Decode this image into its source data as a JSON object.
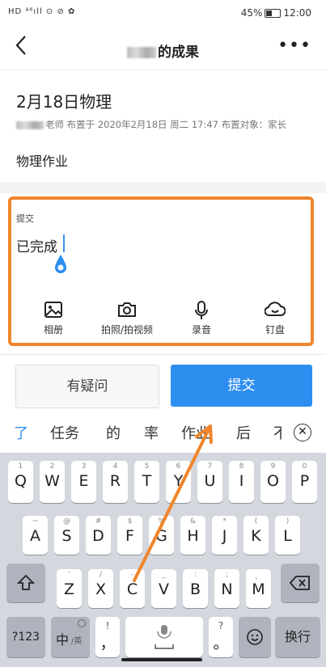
{
  "status": {
    "left": "HD ⁴⁶ıll ⊙ ⊘ ✿",
    "battery": "45%",
    "time": "12:00"
  },
  "nav": {
    "back": "‹",
    "title_suffix": "的成果",
    "more": "•••"
  },
  "assignment": {
    "title": "2月18日物理",
    "meta": "老师 布置于 2020年2月18日 周二 17:47 布置对象：家长",
    "task": "物理作业"
  },
  "submission": {
    "label": "提交",
    "answer": "已完成",
    "tools": [
      {
        "label": "相册",
        "icon": "image-icon"
      },
      {
        "label": "拍照/拍视频",
        "icon": "camera-icon"
      },
      {
        "label": "录音",
        "icon": "microphone-icon"
      },
      {
        "label": "钉盘",
        "icon": "cloud-icon"
      }
    ]
  },
  "buttons": {
    "question": "有疑问",
    "submit": "提交"
  },
  "candidates": [
    "了",
    "任务",
    "的",
    "率",
    "作业",
    "后",
    "不"
  ],
  "keyboard": {
    "row1": [
      {
        "k": "Q",
        "s": "1"
      },
      {
        "k": "W",
        "s": "2"
      },
      {
        "k": "E",
        "s": "3"
      },
      {
        "k": "R",
        "s": "4"
      },
      {
        "k": "T",
        "s": "5"
      },
      {
        "k": "Y",
        "s": "6"
      },
      {
        "k": "U",
        "s": "7"
      },
      {
        "k": "I",
        "s": "8"
      },
      {
        "k": "O",
        "s": "9"
      },
      {
        "k": "P",
        "s": "0"
      }
    ],
    "row2": [
      {
        "k": "A",
        "s": "~"
      },
      {
        "k": "S",
        "s": "@"
      },
      {
        "k": "D",
        "s": "#"
      },
      {
        "k": "F",
        "s": "$"
      },
      {
        "k": "G",
        "s": "%"
      },
      {
        "k": "H",
        "s": "&"
      },
      {
        "k": "J",
        "s": "*"
      },
      {
        "k": "K",
        "s": "("
      },
      {
        "k": "L",
        "s": ")"
      }
    ],
    "row3": [
      {
        "k": "Z",
        "s": "'"
      },
      {
        "k": "X",
        "s": "/"
      },
      {
        "k": "C",
        "s": "-"
      },
      {
        "k": "V",
        "s": "_"
      },
      {
        "k": "B",
        "s": ":"
      },
      {
        "k": "N",
        "s": ";"
      },
      {
        "k": "M",
        "s": "、"
      }
    ],
    "num": "?123",
    "lang": "中",
    "lang_sub": "/英",
    "comma": "，",
    "comma_sup": "!",
    "period": "。",
    "period_sup": "?",
    "enter": "换行"
  },
  "colors": {
    "accent": "#2d8ef0",
    "highlight": "#f0852b"
  }
}
